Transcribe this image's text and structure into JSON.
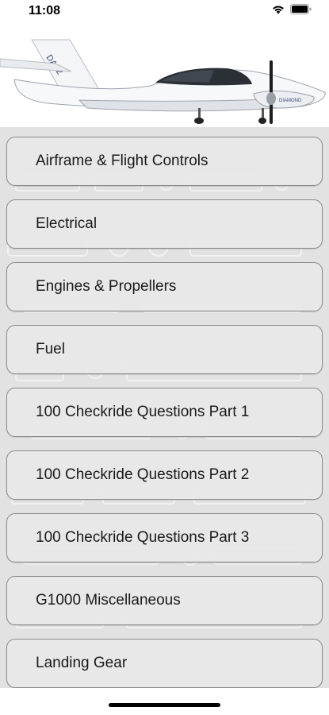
{
  "status_bar": {
    "time": "11:08"
  },
  "header": {
    "aircraft_tail_text": "DA42",
    "aircraft_side_text": "DIAMOND"
  },
  "menu": {
    "items": [
      {
        "label": "Airframe & Flight Controls"
      },
      {
        "label": "Electrical"
      },
      {
        "label": "Engines & Propellers"
      },
      {
        "label": "Fuel"
      },
      {
        "label": "100 Checkride Questions Part 1"
      },
      {
        "label": "100 Checkride Questions Part 2"
      },
      {
        "label": "100 Checkride Questions Part 3"
      },
      {
        "label": "G1000 Miscellaneous"
      },
      {
        "label": "Landing Gear"
      }
    ]
  }
}
